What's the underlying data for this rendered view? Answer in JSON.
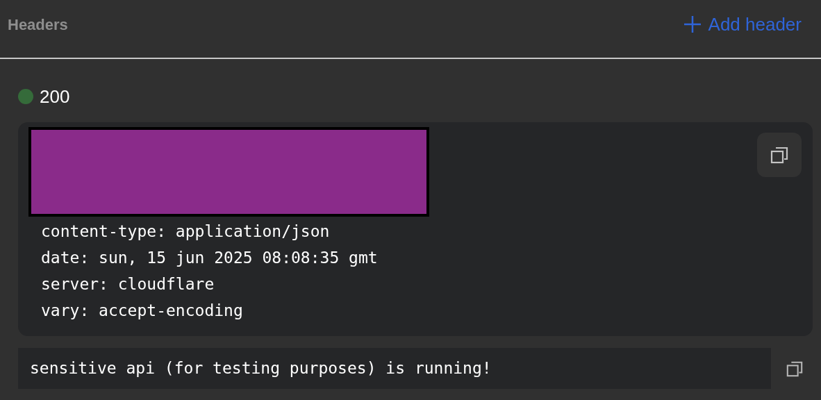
{
  "section": {
    "title": "Headers",
    "action": "Add header"
  },
  "response": {
    "status": {
      "code": "200",
      "color": "#356b3a"
    },
    "headers": [
      {
        "kind": "redacted"
      },
      {
        "kind": "text",
        "text": "content-type: application/json"
      },
      {
        "kind": "text",
        "text": "date: sun, 15 jun 2025 08:08:35 gmt"
      },
      {
        "kind": "text",
        "text": "server: cloudflare"
      },
      {
        "kind": "text",
        "text": "vary: accept-encoding"
      }
    ],
    "body": "sensitive api (for testing purposes) is running!"
  }
}
